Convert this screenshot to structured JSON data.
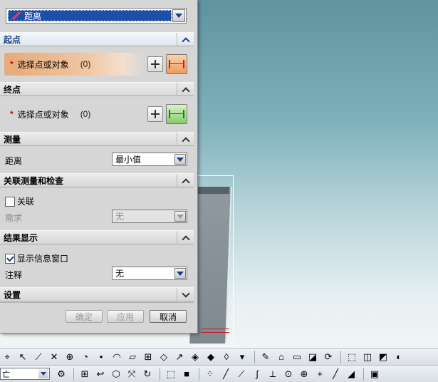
{
  "dialog": {
    "type_dropdown": "距离",
    "sections": {
      "start": {
        "title": "起点",
        "required_mark": "*",
        "select_label": "选择点或对象",
        "count": "(0)"
      },
      "end": {
        "title": "终点",
        "required_mark": "*",
        "select_label": "选择点或对象",
        "count": "(0)"
      },
      "measure": {
        "title": "测量",
        "field_label": "距离",
        "field_value": "最小值"
      },
      "associate": {
        "title": "关联测量和检查",
        "checkbox_label": "关联",
        "requirement_label": "需求",
        "requirement_value": "无"
      },
      "results": {
        "title": "结果显示",
        "checkbox_label": "显示信息窗口",
        "annotation_label": "注释",
        "annotation_value": "无"
      },
      "settings": {
        "title": "设置"
      }
    },
    "buttons": {
      "ok": "确定",
      "apply": "应用",
      "cancel": "取消"
    }
  },
  "bottom_toolbar": {
    "combo_value": "亡"
  },
  "colors": {
    "active_selection": "#e7a978",
    "section_header_blue": "#1b3f8b",
    "required_star": "#d00000"
  }
}
